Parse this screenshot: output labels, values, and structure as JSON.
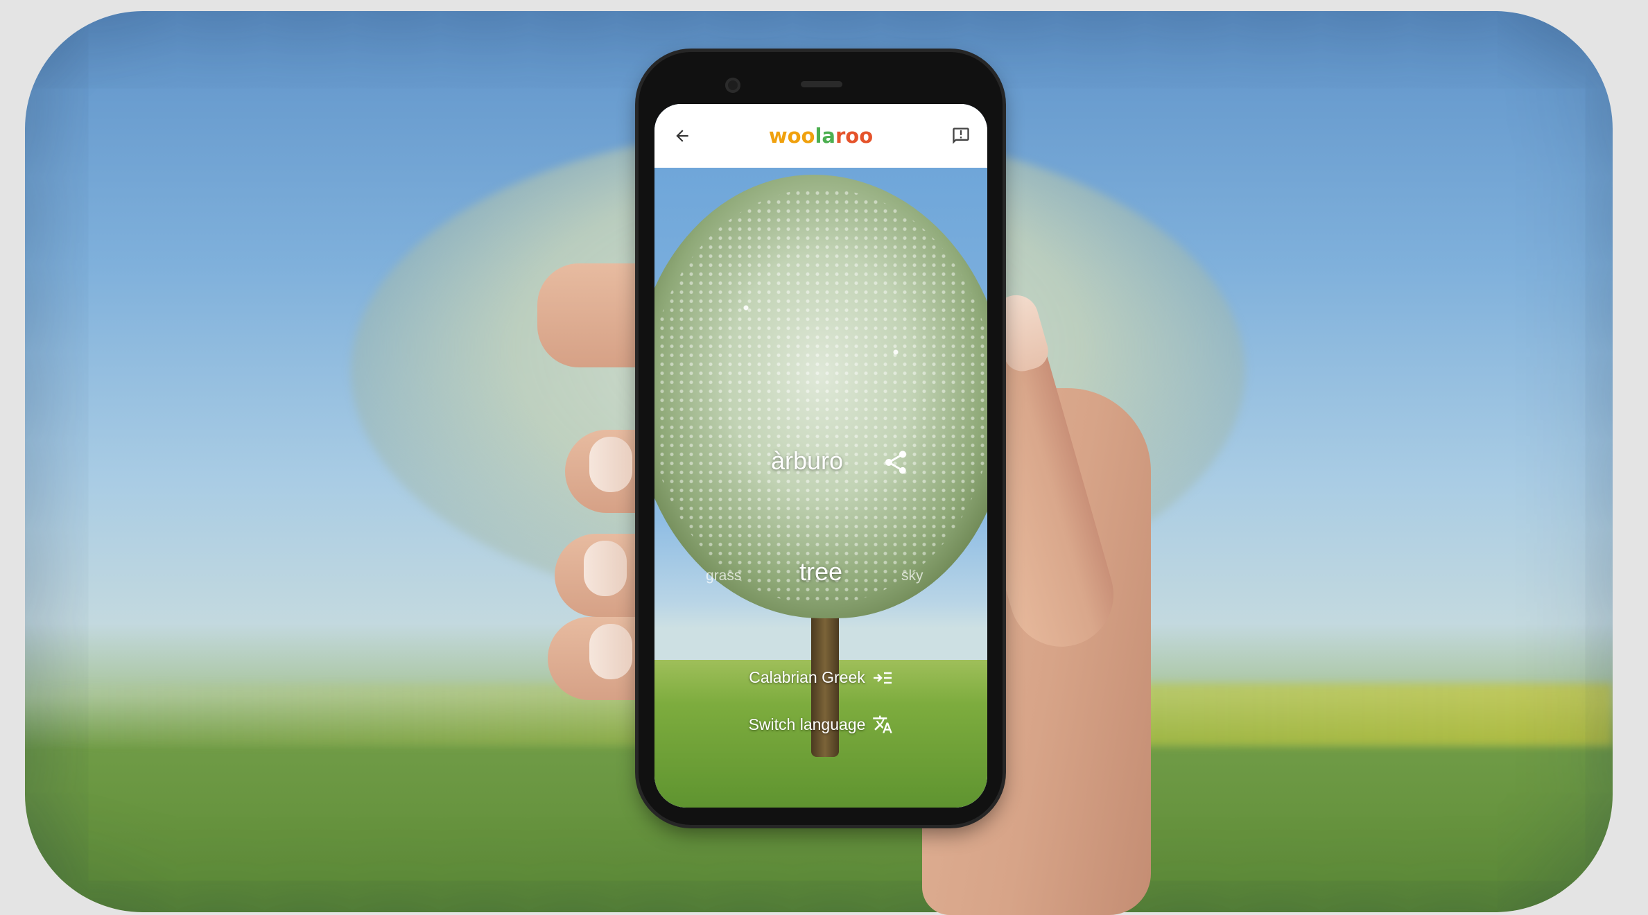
{
  "app": {
    "logo_text": [
      "woo",
      "la",
      "roo"
    ],
    "colors": {
      "logo_orange": "#e69a12",
      "logo_green": "#4caf50",
      "logo_red": "#e5532b"
    }
  },
  "appbar": {
    "back_icon": "arrow-back-icon",
    "feedback_icon": "feedback-icon"
  },
  "result": {
    "translation": "àrburo",
    "word_previous": "grass",
    "word_current": "tree",
    "word_next": "sky",
    "share_icon": "share-icon"
  },
  "language": {
    "current": "Calabrian Greek",
    "current_icon": "language-list-icon",
    "switch_label": "Switch language",
    "switch_icon": "translate-icon"
  }
}
